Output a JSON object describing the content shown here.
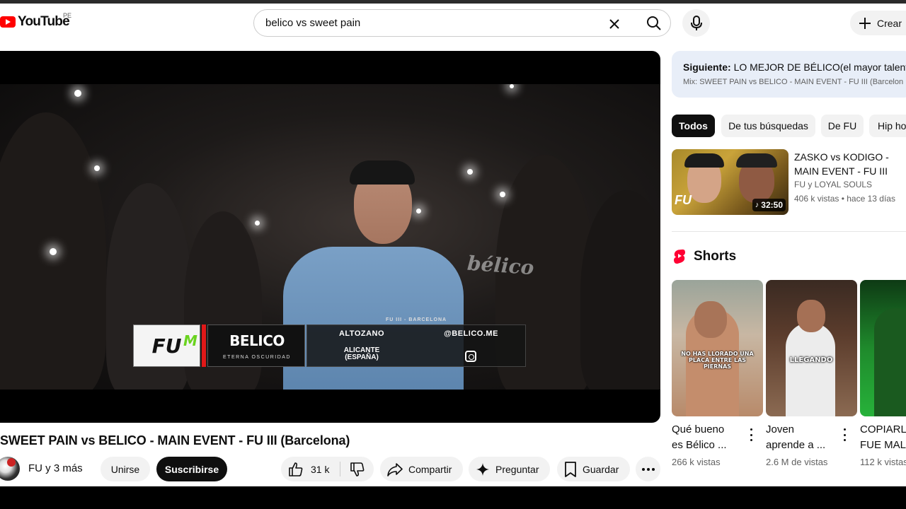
{
  "header": {
    "logo_text": "YouTube",
    "country_code": "PE",
    "search_value": "belico vs sweet pain",
    "create_label": "Crear"
  },
  "player": {
    "overlay": {
      "fu_logo": "FU",
      "name": "BELICO",
      "tagline": "ETERNA OSCURIDAD",
      "event": "FU III - BARCELONA",
      "place1": "ALTOZANO",
      "place2_line1": "ALICANTE",
      "place2_line2": "(ESPAÑA)",
      "handle": "@BELICO.ME"
    },
    "banner_text": "bélico"
  },
  "video": {
    "title": "SWEET PAIN vs BELICO - MAIN EVENT - FU III (Barcelona)",
    "channel": "FU y 3 más",
    "join_label": "Unirse",
    "subscribe_label": "Suscribirse",
    "likes": "31 k",
    "share_label": "Compartir",
    "ask_label": "Preguntar",
    "save_label": "Guardar"
  },
  "sidebar": {
    "next": {
      "label": "Siguiente:",
      "title": "LO MEJOR DE BÉLICO(el mayor talento d",
      "mix": "Mix: SWEET PAIN vs BELICO - MAIN EVENT - FU III (Barcelon"
    },
    "chips": [
      "Todos",
      "De tus búsquedas",
      "De FU",
      "Hip ho"
    ],
    "recommended": [
      {
        "title": "ZASKO vs KODIGO - MAIN EVENT - FU III (Barcelona)",
        "channel": "FU y LOYAL SOULS",
        "views": "406 k vistas",
        "age": "hace 13 días",
        "duration": "32:50",
        "thumb_logo": "FU"
      }
    ],
    "shorts_heading": "Shorts",
    "shorts": [
      {
        "title_line1": "Qué bueno",
        "title_line2": "es Bélico ...",
        "views": "266 k vistas",
        "caption": "NO HAS LLORADO UNA PLACA ENTRE LAS PIERNAS"
      },
      {
        "title_line1": "Joven",
        "title_line2": "aprende a ...",
        "views": "2.6 M de vistas",
        "caption": "LLEGANDO"
      },
      {
        "title_line1": "COPIARL",
        "title_line2": "FUE MAL",
        "views": "112 k vistas",
        "caption": ""
      }
    ]
  },
  "colors": {
    "brand_red": "#ff0000",
    "subscribe_bg": "#0f0f0f",
    "next_box_bg": "#e8eef8",
    "chip_bg": "#f2f2f2"
  }
}
